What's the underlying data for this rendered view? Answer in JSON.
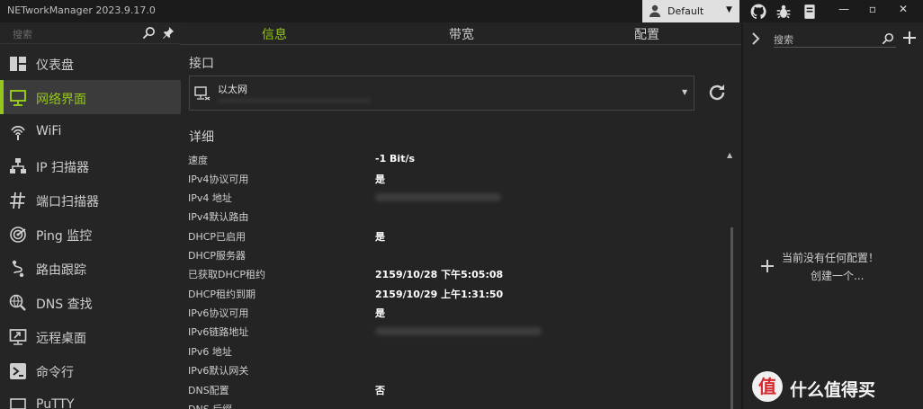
{
  "window": {
    "title": "NETworkManager 2023.9.17.0",
    "profile": "Default"
  },
  "sidebar": {
    "search_placeholder": "搜索",
    "items": [
      {
        "label": "仪表盘",
        "icon": "dashboard-icon"
      },
      {
        "label": "网络界面",
        "icon": "network-interface-icon"
      },
      {
        "label": "WiFi",
        "icon": "wifi-icon"
      },
      {
        "label": "IP 扫描器",
        "icon": "ip-scanner-icon"
      },
      {
        "label": "端口扫描器",
        "icon": "port-scanner-icon"
      },
      {
        "label": "Ping 监控",
        "icon": "ping-monitor-icon"
      },
      {
        "label": "路由跟踪",
        "icon": "traceroute-icon"
      },
      {
        "label": "DNS 查找",
        "icon": "dns-lookup-icon"
      },
      {
        "label": "远程桌面",
        "icon": "remote-desktop-icon"
      },
      {
        "label": "命令行",
        "icon": "terminal-icon"
      },
      {
        "label": "PuTTY",
        "icon": "putty-icon"
      }
    ]
  },
  "tabs": [
    "信息",
    "带宽",
    "配置"
  ],
  "interface": {
    "section_title": "接口",
    "name": "以太网"
  },
  "details": {
    "section_title": "详细",
    "rows": [
      {
        "key": "速度",
        "value": "-1 Bit/s"
      },
      {
        "key": "IPv4协议可用",
        "value": "是"
      },
      {
        "key": "IPv4 地址",
        "value": ""
      },
      {
        "key": "IPv4默认路由",
        "value": ""
      },
      {
        "key": "DHCP已启用",
        "value": "是"
      },
      {
        "key": "DHCP服务器",
        "value": ""
      },
      {
        "key": "已获取DHCP租约",
        "value": "2159/10/28 下午5:05:08"
      },
      {
        "key": "DHCP租约到期",
        "value": "2159/10/29 上午1:31:50"
      },
      {
        "key": "IPv6协议可用",
        "value": "是"
      },
      {
        "key": "IPv6链路地址",
        "value": ""
      },
      {
        "key": "IPv6 地址",
        "value": ""
      },
      {
        "key": "IPv6默认网关",
        "value": ""
      },
      {
        "key": "DNS配置",
        "value": "否"
      },
      {
        "key": "DNS 后缀",
        "value": ""
      }
    ]
  },
  "profiles_panel": {
    "search_placeholder": "搜索",
    "empty_line1": "当前没有任何配置！",
    "empty_line2": "创建一个..."
  },
  "watermark": {
    "logo": "值",
    "text": "什么值得买"
  },
  "colors": {
    "accent": "#93c71b",
    "background": "#242424",
    "sidebar": "#252525"
  }
}
